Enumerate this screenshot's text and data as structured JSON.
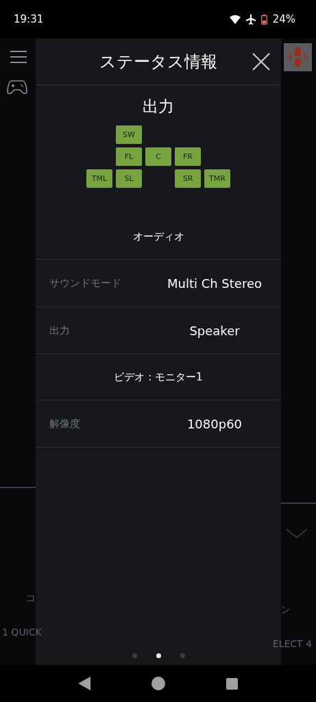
{
  "status_bar": {
    "time": "19:31",
    "battery": "24%"
  },
  "background": {
    "left_texts": [
      "コ",
      "1 QUICK"
    ],
    "right_texts": [
      "ン",
      "ELECT 4"
    ]
  },
  "dialog": {
    "title": "ステータス情報",
    "output_title": "出力",
    "speaker_rows": [
      {
        "cells": [
          {
            "kind": "gap"
          },
          {
            "kind": "speaker",
            "label": "SW"
          },
          {
            "kind": "gap"
          },
          {
            "kind": "gap"
          },
          {
            "kind": "gap"
          }
        ]
      },
      {
        "cells": [
          {
            "kind": "gap"
          },
          {
            "kind": "speaker",
            "label": "FL"
          },
          {
            "kind": "speaker",
            "label": "C"
          },
          {
            "kind": "speaker",
            "label": "FR"
          },
          {
            "kind": "gap"
          }
        ]
      },
      {
        "cells": [
          {
            "kind": "speaker",
            "label": "TML"
          },
          {
            "kind": "speaker",
            "label": "SL"
          },
          {
            "kind": "gap"
          },
          {
            "kind": "speaker",
            "label": "SR"
          },
          {
            "kind": "speaker",
            "label": "TMR"
          }
        ]
      }
    ],
    "rows": [
      {
        "kind": "header",
        "text": "オーディオ"
      },
      {
        "kind": "item",
        "label": "サウンドモード",
        "value": "Multi Ch Stereo"
      },
      {
        "kind": "item",
        "label": "出力",
        "value": "Speaker"
      },
      {
        "kind": "header",
        "text": "ビデオ : モニター1"
      },
      {
        "kind": "item",
        "label": "解像度",
        "value": "1080p60"
      }
    ],
    "pages": [
      {
        "selected": false
      },
      {
        "selected": true
      },
      {
        "selected": false
      }
    ]
  }
}
